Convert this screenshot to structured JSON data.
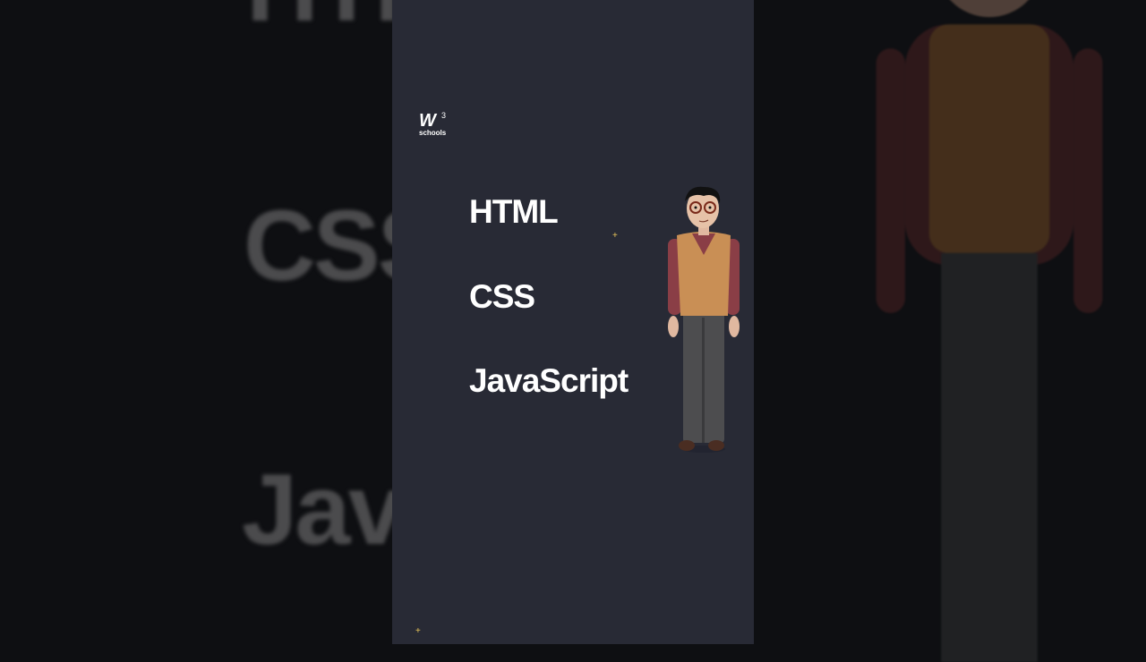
{
  "logo": {
    "mark": "W",
    "superscript": "3",
    "wordmark": "schools"
  },
  "topics": [
    "HTML",
    "CSS",
    "JavaScript"
  ],
  "background_text": [
    "HTM",
    "CSS",
    "Java"
  ],
  "colors": {
    "panel": "#282a35",
    "backdrop": "#0e0f12",
    "sparkle": "#e8c55a"
  }
}
